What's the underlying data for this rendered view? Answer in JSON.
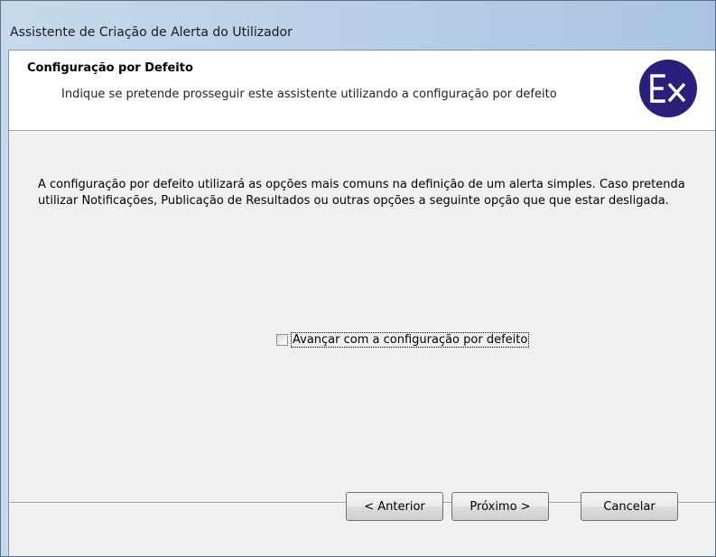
{
  "window": {
    "title": "Assistente de Criação de Alerta do Utilizador"
  },
  "header": {
    "title": "Configuração por Defeito",
    "subtitle": "Indique se pretende prosseguir este assistente utilizando a configuração por defeito",
    "logo_text": "Ex",
    "logo_color": "#2b1f7c"
  },
  "body": {
    "description": "A configuração por defeito utilizará as opções mais comuns na definição de um alerta simples. Caso pretenda utilizar Notificações, Publicação de Resultados ou outras opções a seguinte opção que que estar desligada."
  },
  "option": {
    "label": "Avançar com a configuração por defeito",
    "checked": false
  },
  "buttons": {
    "previous": "< Anterior",
    "next": "Próximo >",
    "cancel": "Cancelar"
  }
}
